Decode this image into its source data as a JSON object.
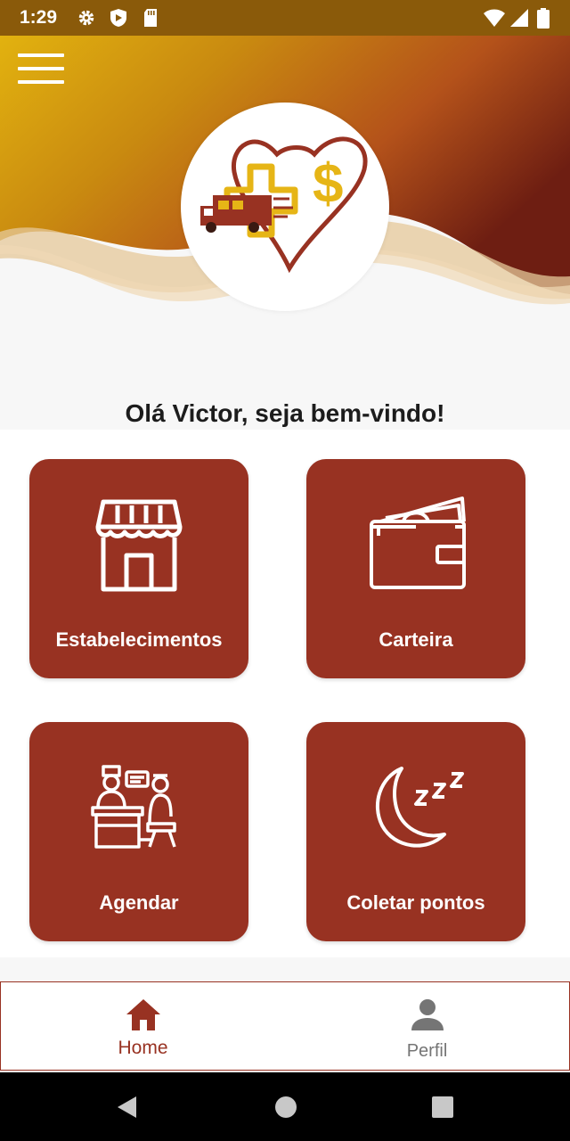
{
  "status_bar": {
    "time": "1:29",
    "icons": [
      "gear-icon",
      "shield-icon",
      "sd-card-icon",
      "wifi-icon",
      "signal-icon",
      "battery-icon"
    ]
  },
  "header": {
    "menu_icon": "hamburger-menu-icon",
    "logo": "truck-cross-heart-dollar-logo",
    "greeting": "Olá Victor, seja bem-vindo!"
  },
  "cards": [
    {
      "label": "Estabelecimentos",
      "icon": "storefront-icon"
    },
    {
      "label": "Carteira",
      "icon": "wallet-icon"
    },
    {
      "label": "Agendar",
      "icon": "appointment-desk-icon"
    },
    {
      "label": "Coletar pontos",
      "icon": "moon-sleep-icon"
    }
  ],
  "bottom_nav": [
    {
      "label": "Home",
      "icon": "home-icon",
      "active": true
    },
    {
      "label": "Perfil",
      "icon": "person-icon",
      "active": false
    }
  ],
  "android_nav": [
    "back-icon",
    "home-circle-icon",
    "recents-icon"
  ],
  "colors": {
    "brand": "#983222",
    "gold": "#e6b516",
    "active_nav": "#983222",
    "inactive_nav": "#757575"
  }
}
